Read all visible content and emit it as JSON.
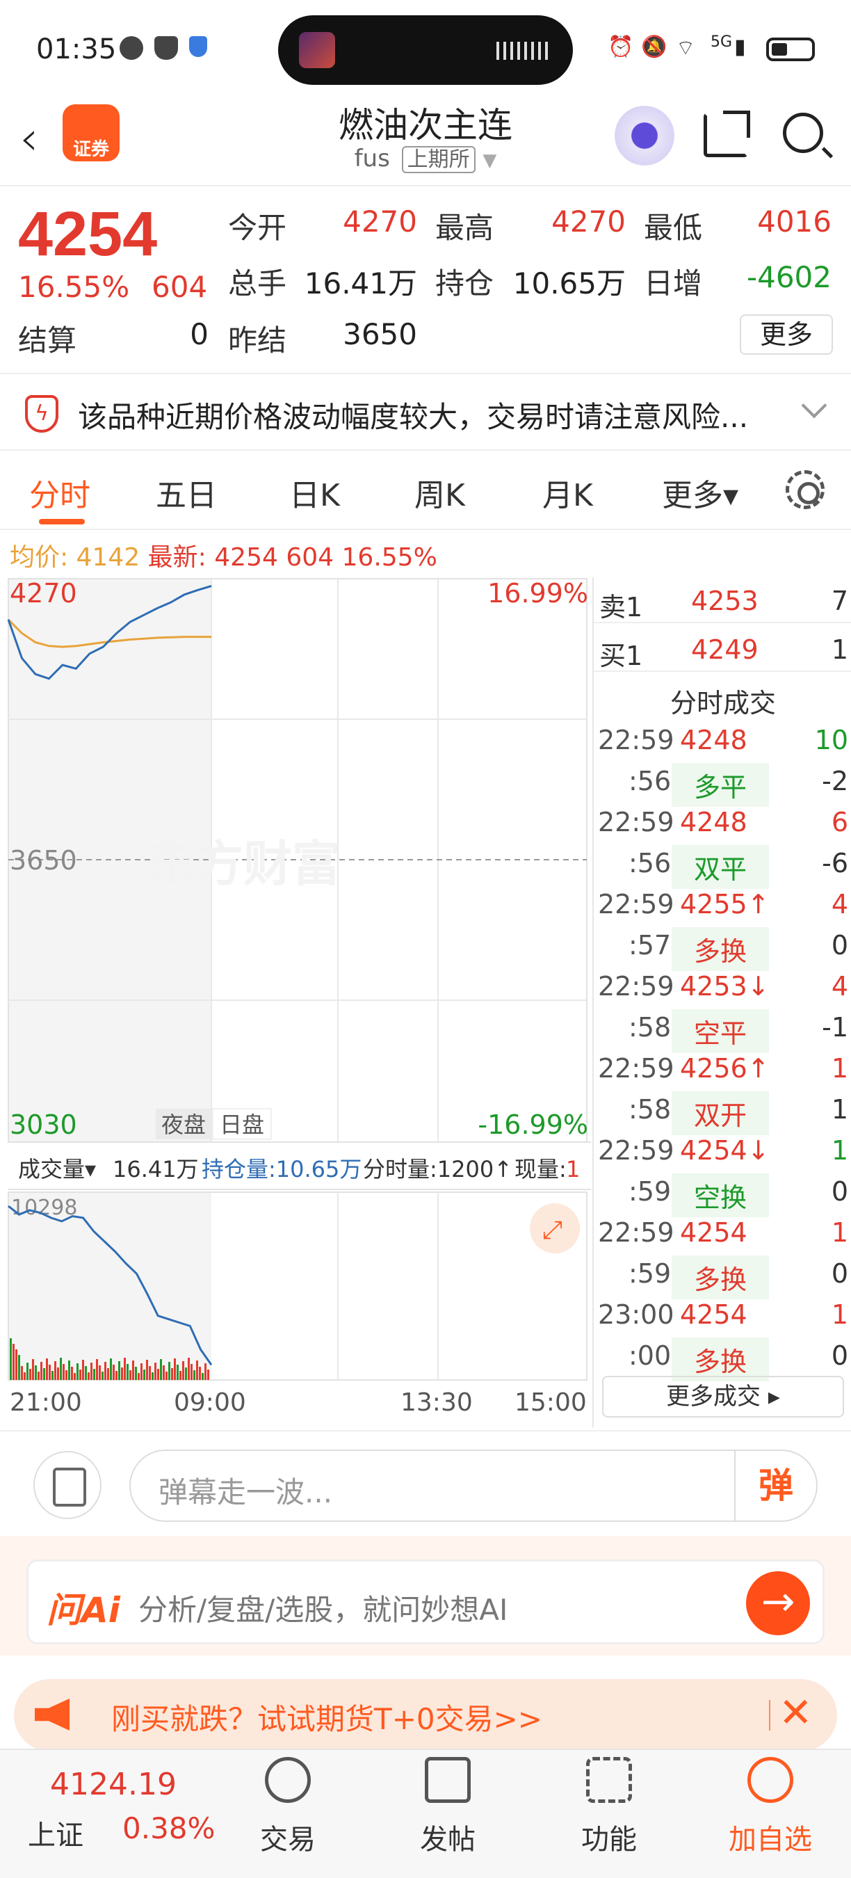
{
  "status_bar": {
    "time": "01:35",
    "network": "5G"
  },
  "header": {
    "title": "燃油次主连",
    "code": "fus",
    "exchange": "上期所",
    "logo_label": "证券"
  },
  "quote": {
    "price": "4254",
    "change_pct": "16.55%",
    "change": "604",
    "labels": {
      "open": "今开",
      "high": "最高",
      "low": "最低",
      "volume": "总手",
      "position": "持仓",
      "daily_inc": "日增",
      "settle": "结算",
      "prev_settle": "昨结"
    },
    "open": "4270",
    "high": "4270",
    "low": "4016",
    "volume": "16.41万",
    "position": "10.65万",
    "daily_inc": "-4602",
    "settle": "0",
    "prev_settle": "3650",
    "more": "更多"
  },
  "risk_notice": "该品种近期价格波动幅度较大，交易时请注意风险...",
  "tabs": [
    "分时",
    "五日",
    "日K",
    "周K",
    "月K",
    "更多▾"
  ],
  "summary": {
    "avg_label": "均价:",
    "avg": "4142",
    "latest_label": "最新:",
    "latest": "4254",
    "change": "604",
    "pct": "16.55%"
  },
  "chart": {
    "watermark": "东方财富",
    "y_top": "4270",
    "y_mid": "3650",
    "y_bottom": "3030",
    "pct_top": "16.99%",
    "pct_bottom": "-16.99%",
    "session_night": "夜盘",
    "session_day": "日盘",
    "vol_bar": {
      "label": "成交量▾",
      "vol": "16.41万",
      "pos": "持仓量:10.65万",
      "tick": "分时量:1200↑",
      "now_label": "现量:",
      "now": "1"
    },
    "vol_max": "10298",
    "times": [
      "21:00",
      "09:00",
      "13:30",
      "15:00"
    ]
  },
  "chart_data": {
    "type": "line",
    "title": "",
    "ylim": [
      3030,
      4270
    ],
    "series": [
      {
        "values": [
          4180,
          4095,
          4060,
          4050,
          4080,
          4072,
          4105,
          4120,
          4150,
          4175,
          4190,
          4205,
          4218,
          4235,
          4245,
          4254
        ]
      },
      {
        "values": [
          4180,
          4150,
          4130,
          4122,
          4120,
          4122,
          4126,
          4130,
          4133,
          4136,
          4138,
          4140,
          4141,
          4142,
          4142,
          4142
        ]
      }
    ],
    "volume": [
      10298,
      9800,
      10050,
      9900,
      9600,
      9400,
      9700,
      9600,
      8800,
      8200,
      7600,
      6900,
      6300,
      5100,
      3800,
      3600,
      3400,
      3200,
      1800,
      900
    ]
  },
  "orderbook": [
    {
      "side": "卖1",
      "price": "4253",
      "qty": "7"
    },
    {
      "side": "买1",
      "price": "4249",
      "qty": "1"
    }
  ],
  "trades_title": "分时成交",
  "trades": [
    {
      "time": "22:59",
      "price": "4248",
      "qty": "10",
      "qcolor": "green"
    },
    {
      "time": ":56",
      "type": "多平",
      "qty": "-2",
      "tcolor": "green"
    },
    {
      "time": "22:59",
      "price": "4248",
      "qty": "6",
      "qcolor": "red"
    },
    {
      "time": ":56",
      "type": "双平",
      "qty": "-6",
      "tcolor": "green"
    },
    {
      "time": "22:59",
      "price": "4255↑",
      "qty": "4",
      "qcolor": "red"
    },
    {
      "time": ":57",
      "type": "多换",
      "qty": "0",
      "tcolor": "red"
    },
    {
      "time": "22:59",
      "price": "4253↓",
      "qty": "4",
      "qcolor": "red"
    },
    {
      "time": ":58",
      "type": "空平",
      "qty": "-1",
      "tcolor": "red"
    },
    {
      "time": "22:59",
      "price": "4256↑",
      "qty": "1",
      "qcolor": "red"
    },
    {
      "time": ":58",
      "type": "双开",
      "qty": "1",
      "tcolor": "red"
    },
    {
      "time": "22:59",
      "price": "4254↓",
      "qty": "1",
      "qcolor": "green"
    },
    {
      "time": ":59",
      "type": "空换",
      "qty": "0",
      "tcolor": "green"
    },
    {
      "time": "22:59",
      "price": "4254",
      "qty": "1",
      "qcolor": "red"
    },
    {
      "time": ":59",
      "type": "多换",
      "qty": "0",
      "tcolor": "red"
    },
    {
      "time": "23:00",
      "price": "4254",
      "qty": "1",
      "qcolor": "red"
    },
    {
      "time": ":00",
      "type": "多换",
      "qty": "0",
      "tcolor": "red"
    }
  ],
  "more_trades": "更多成交 ▸",
  "danmu": {
    "placeholder": "弹幕走一波...",
    "button": "弹"
  },
  "ai": {
    "brand": "问Ai",
    "placeholder": "分析/复盘/选股，就问妙想AI",
    "go": "→"
  },
  "promo": {
    "text": "刚买就跌？试试期货T+0交易>>",
    "close": "✕"
  },
  "bottom": {
    "index_value": "4124.19",
    "index_name": "上证",
    "index_pct": "0.38%",
    "nav": [
      "交易",
      "发帖",
      "功能",
      "加自选"
    ]
  },
  "colors": {
    "red": "#e23a2e",
    "green": "#1c9a2a",
    "accent": "#ff5a1f",
    "price_line": "#2e6db4",
    "avg_line": "#e8a33a"
  }
}
